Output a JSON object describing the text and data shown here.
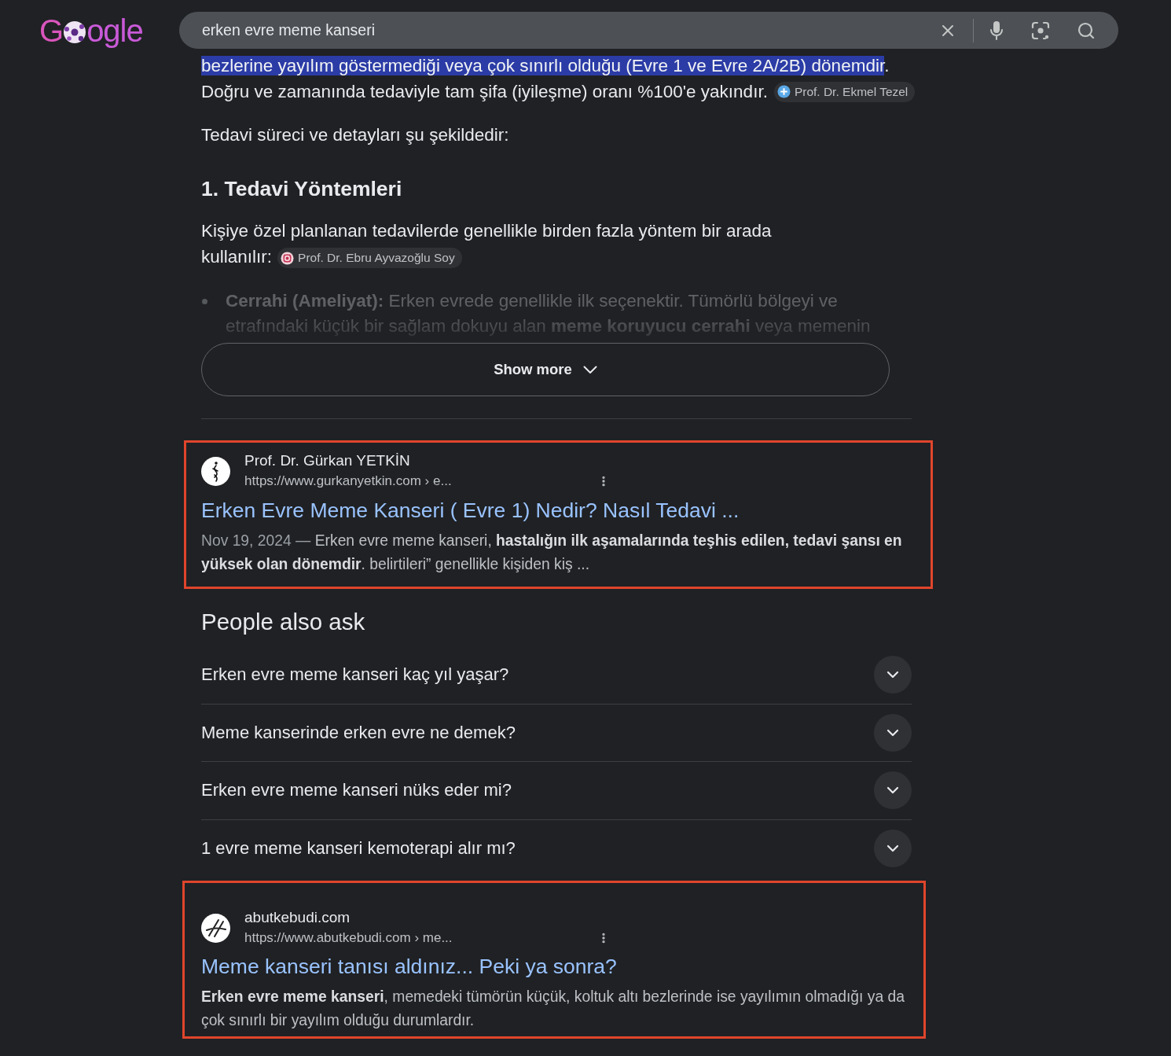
{
  "logo": {
    "text_start": "G",
    "text_end": "ogle"
  },
  "search": {
    "value": "erken evre meme kanseri"
  },
  "overview": {
    "selected_text": "bezlerine yayılım göstermediği veya çok sınırlı olduğu (Evre 1 ve Evre 2A/2B) dönemdir",
    "text_after_selection": ".",
    "sentence": {
      "text": "Doğru ve zamanında tedaviyle tam şifa (iyileşme) oranı %100'e yakındır.",
      "source": {
        "name": "Prof. Dr. Ekmel Tezel",
        "kind": "medical"
      }
    },
    "lead": "Tedavi süreci ve detayları şu şekildedir:",
    "heading": "1. Tedavi Yöntemleri",
    "paragraph": {
      "text": "Kişiye özel planlanan tedavilerde genellikle birden fazla yöntem bir arada kullanılır:",
      "source": {
        "name": "Prof. Dr. Ebru Ayvazoğlu Soy",
        "kind": "emblem"
      }
    },
    "bullets": [
      {
        "text": "**Cerrahi (Ameliyat):** Erken evrede genellikle ilk seçenektir. Tümörlü bölgeyi ve etrafındaki küçük bir sağlam dokuyu alan **meme koruyucu cerrahi** veya memenin"
      }
    ],
    "show_more": "Show more"
  },
  "feed": [
    {
      "kind": "result",
      "highlighted": true,
      "favicon": {
        "kind": "figure"
      },
      "site": "Prof. Dr. Gürkan YETKİN",
      "url": "https://www.gurkanyetkin.com › e...",
      "title": "Erken Evre Meme Kanseri ( Evre 1) Nedir? Nasıl Tedavi ...",
      "date": "Nov 19, 2024 —",
      "snippet": "Erken evre meme kanseri, **hastalığın ilk aşamalarında teşhis edilen, tedavi şansı en yüksek olan dönemdir**. belirtileri” genellikle kişiden kiş ..."
    },
    {
      "kind": "questions",
      "title": "People also ask",
      "questions": [
        {
          "text": "Erken evre meme kanseri kaç yıl yaşar?",
          "expanded": false
        },
        {
          "text": "Meme kanserinde erken evre ne demek?",
          "expanded": false
        },
        {
          "text": "Erken evre meme kanseri nüks eder mi?",
          "expanded": false
        },
        {
          "text": "1 evre meme kanseri kemoterapi alır mı?",
          "expanded": false
        }
      ]
    },
    {
      "kind": "result",
      "highlighted": true,
      "favicon": {
        "kind": "slash"
      },
      "site": "abutkebudi.com",
      "url": "https://www.abutkebudi.com › me...",
      "title": "Meme kanseri tanısı aldınız... Peki ya sonra?",
      "snippet": "**Erken evre meme kanseri**, memedeki tümörün küçük, koltuk altı bezlerinde ise yayılımın olmadığı ya da çok sınırlı bir yayılım olduğu durumlardır."
    }
  ]
}
